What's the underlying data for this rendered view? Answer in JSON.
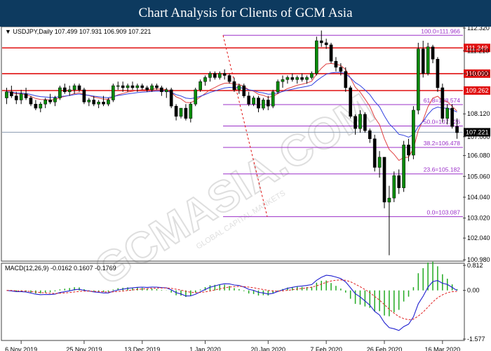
{
  "header": {
    "title": "Chart Analysis for Clients of GCM Asia"
  },
  "watermark": {
    "text": "GCMASIA.COM",
    "sub": "GLOBAL CAPITAL MARKETS"
  },
  "chart_data": [
    {
      "type": "candlestick",
      "symbol_label": "USDJPY,Daily",
      "ohlc_label": "107.499 107.931 106.909 107.221",
      "ylim": [
        100.98,
        112.32
      ],
      "y_ticks": [
        "112.320",
        "111.210",
        "110.090",
        "108.120",
        "107.000",
        "106.080",
        "105.060",
        "104.040",
        "103.020",
        "102.040",
        "100.980"
      ],
      "last_price": "107.221",
      "x_ticks": [
        "6 Nov 2019",
        "25 Nov 2019",
        "13 Dec 2019",
        "1 Jan 2020",
        "20 Jan 2020",
        "7 Feb 2020",
        "26 Feb 2020",
        "16 Mar 2020"
      ],
      "resistance_levels": [
        {
          "label": "111.349",
          "value": 111.349
        },
        {
          "label": "110.090",
          "value": 110.09
        },
        {
          "label": "109.262",
          "value": 109.262
        }
      ],
      "fibonacci_levels": [
        {
          "label": "100.0=111.966",
          "value": 111.966
        },
        {
          "label": "61.8=108.574",
          "value": 108.574
        },
        {
          "label": "50.0=107.526",
          "value": 107.526
        },
        {
          "label": "38.2=106.478",
          "value": 106.478
        },
        {
          "label": "23.6=105.182",
          "value": 105.182
        },
        {
          "label": "0.0=103.087",
          "value": 103.087
        }
      ],
      "candles": [
        [
          108.9,
          109.4,
          108.6,
          109.2
        ],
        [
          109.2,
          109.5,
          108.9,
          109.0
        ],
        [
          109.0,
          109.2,
          108.6,
          108.8
        ],
        [
          108.8,
          109.3,
          108.6,
          109.1
        ],
        [
          109.1,
          109.4,
          108.8,
          108.9
        ],
        [
          108.9,
          109.0,
          108.5,
          108.6
        ],
        [
          108.6,
          108.8,
          108.3,
          108.4
        ],
        [
          108.4,
          108.7,
          108.2,
          108.6
        ],
        [
          108.6,
          108.9,
          108.4,
          108.8
        ],
        [
          108.8,
          109.1,
          108.6,
          108.7
        ],
        [
          108.7,
          109.0,
          108.5,
          108.9
        ],
        [
          108.9,
          109.5,
          108.8,
          109.4
        ],
        [
          109.4,
          109.6,
          109.1,
          109.2
        ],
        [
          109.2,
          109.5,
          109.0,
          109.3
        ],
        [
          109.3,
          109.6,
          109.1,
          109.5
        ],
        [
          109.5,
          109.6,
          109.2,
          109.3
        ],
        [
          109.3,
          109.4,
          108.6,
          108.7
        ],
        [
          108.7,
          108.9,
          108.5,
          108.8
        ],
        [
          108.8,
          109.0,
          108.5,
          108.6
        ],
        [
          108.6,
          108.8,
          108.4,
          108.7
        ],
        [
          108.7,
          109.0,
          108.5,
          108.6
        ],
        [
          108.6,
          108.9,
          108.5,
          108.8
        ],
        [
          108.8,
          109.6,
          108.7,
          109.5
        ],
        [
          109.5,
          109.7,
          109.3,
          109.5
        ],
        [
          109.5,
          109.7,
          109.2,
          109.4
        ],
        [
          109.4,
          109.6,
          109.2,
          109.5
        ],
        [
          109.5,
          109.7,
          109.3,
          109.4
        ],
        [
          109.4,
          109.6,
          109.2,
          109.5
        ],
        [
          109.5,
          109.6,
          109.3,
          109.4
        ],
        [
          109.4,
          109.5,
          109.2,
          109.3
        ],
        [
          109.3,
          109.6,
          109.2,
          109.5
        ],
        [
          109.5,
          109.6,
          109.3,
          109.4
        ],
        [
          109.4,
          109.5,
          109.0,
          109.2
        ],
        [
          109.2,
          109.4,
          108.9,
          109.3
        ],
        [
          109.3,
          109.4,
          108.4,
          108.5
        ],
        [
          108.5,
          108.6,
          107.8,
          108.0
        ],
        [
          108.0,
          108.4,
          107.9,
          108.4
        ],
        [
          108.4,
          108.6,
          107.8,
          107.9
        ],
        [
          107.9,
          108.7,
          107.7,
          108.6
        ],
        [
          108.6,
          109.4,
          108.5,
          109.3
        ],
        [
          109.3,
          109.8,
          109.2,
          109.7
        ],
        [
          109.7,
          110.0,
          109.5,
          109.9
        ],
        [
          109.9,
          110.2,
          109.7,
          110.1
        ],
        [
          110.1,
          110.2,
          109.8,
          109.9
        ],
        [
          109.9,
          110.2,
          109.8,
          110.1
        ],
        [
          110.1,
          110.3,
          109.8,
          110.0
        ],
        [
          110.0,
          110.1,
          109.6,
          109.7
        ],
        [
          109.7,
          109.9,
          109.2,
          109.3
        ],
        [
          109.3,
          109.6,
          109.1,
          109.5
        ],
        [
          109.5,
          109.6,
          108.9,
          109.0
        ],
        [
          109.0,
          109.2,
          108.5,
          108.6
        ],
        [
          108.6,
          109.0,
          108.5,
          108.9
        ],
        [
          108.9,
          109.0,
          108.2,
          108.4
        ],
        [
          108.4,
          108.9,
          108.3,
          108.8
        ],
        [
          108.8,
          109.0,
          108.3,
          108.5
        ],
        [
          108.5,
          109.3,
          108.4,
          109.2
        ],
        [
          109.2,
          109.8,
          109.1,
          109.7
        ],
        [
          109.7,
          110.0,
          109.4,
          109.8
        ],
        [
          109.8,
          110.0,
          109.6,
          109.9
        ],
        [
          109.9,
          110.1,
          109.7,
          109.8
        ],
        [
          109.8,
          110.0,
          109.6,
          109.9
        ],
        [
          109.9,
          110.1,
          109.7,
          109.8
        ],
        [
          109.8,
          110.0,
          109.6,
          109.9
        ],
        [
          109.9,
          110.2,
          109.8,
          110.1
        ],
        [
          110.1,
          111.9,
          110.0,
          111.7
        ],
        [
          111.7,
          112.2,
          111.4,
          111.6
        ],
        [
          111.6,
          111.8,
          111.3,
          111.5
        ],
        [
          111.5,
          111.6,
          110.6,
          110.7
        ],
        [
          110.7,
          110.9,
          110.2,
          110.4
        ],
        [
          110.4,
          110.6,
          110.0,
          110.2
        ],
        [
          110.2,
          110.4,
          109.2,
          109.4
        ],
        [
          109.4,
          109.5,
          107.9,
          108.0
        ],
        [
          108.0,
          108.1,
          107.1,
          107.4
        ],
        [
          107.4,
          108.3,
          107.2,
          108.1
        ],
        [
          108.1,
          108.2,
          107.2,
          107.3
        ],
        [
          107.3,
          107.4,
          106.7,
          106.9
        ],
        [
          106.9,
          107.1,
          105.3,
          105.5
        ],
        [
          105.5,
          106.3,
          105.0,
          106.0
        ],
        [
          106.0,
          106.0,
          103.5,
          103.8
        ],
        [
          103.8,
          104.6,
          101.2,
          104.0
        ],
        [
          104.0,
          105.3,
          103.8,
          105.1
        ],
        [
          105.1,
          105.4,
          104.2,
          104.5
        ],
        [
          104.5,
          106.8,
          104.3,
          106.6
        ],
        [
          106.6,
          106.9,
          105.8,
          106.1
        ],
        [
          106.1,
          108.5,
          105.9,
          108.3
        ],
        [
          108.3,
          111.6,
          108.1,
          111.3
        ],
        [
          111.3,
          111.7,
          109.9,
          110.1
        ],
        [
          110.1,
          111.6,
          110.0,
          111.4
        ],
        [
          111.4,
          111.5,
          110.6,
          110.8
        ],
        [
          110.8,
          110.9,
          109.2,
          109.4
        ],
        [
          109.4,
          109.6,
          107.7,
          107.9
        ],
        [
          107.9,
          108.6,
          107.6,
          108.4
        ],
        [
          108.4,
          108.6,
          107.4,
          107.5
        ],
        [
          107.5,
          107.9,
          106.9,
          107.2
        ]
      ]
    },
    {
      "type": "macd",
      "label": "MACD(12,26,9) -0.0162 0.1607 -0.1769",
      "ylim": [
        -1.577,
        0.812
      ],
      "y_ticks": [
        "0.812",
        "0.00",
        "-1.577"
      ]
    }
  ],
  "colors": {
    "bull": "#0a8a0a",
    "bear": "#000000",
    "resistance": "#e01010",
    "fib": "#9b30c8",
    "ma_fast": "#e04040",
    "ma_slow": "#3040e0",
    "macd_line": "#2020d0",
    "signal_line": "#e02020",
    "hist": "#22aa22"
  }
}
